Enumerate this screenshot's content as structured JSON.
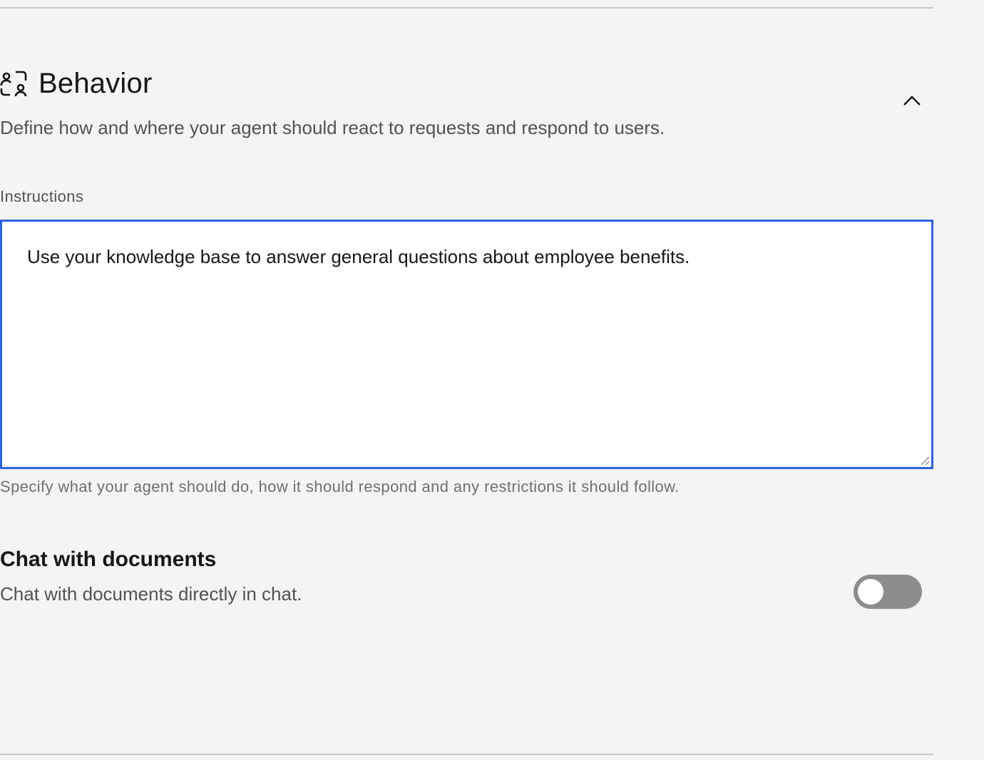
{
  "section": {
    "title": "Behavior",
    "description": "Define how and where your agent should react to requests and respond to users.",
    "icon": "user-behavior-icon"
  },
  "instructions": {
    "label": "Instructions",
    "value": "Use your knowledge base to answer general questions about employee benefits.",
    "helper": "Specify what your agent should do, how it should respond and any restrictions it should follow."
  },
  "chat_with_documents": {
    "title": "Chat with documents",
    "description": "Chat with documents directly in chat.",
    "enabled": false
  },
  "colors": {
    "focus_border": "#2f63dd",
    "toggle_off": "#8d8d8d",
    "background": "#f4f4f4"
  }
}
